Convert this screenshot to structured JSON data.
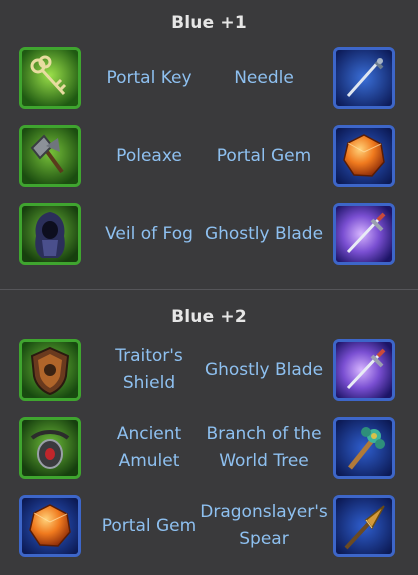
{
  "sections": [
    {
      "title": "Blue +1",
      "rows": [
        {
          "left": {
            "name": "Portal Key",
            "icon": "portal-key-icon"
          },
          "right": {
            "name": "Needle",
            "icon": "needle-icon"
          }
        },
        {
          "left": {
            "name": "Poleaxe",
            "icon": "poleaxe-icon"
          },
          "right": {
            "name": "Portal Gem",
            "icon": "portal-gem-icon"
          }
        },
        {
          "left": {
            "name": "Veil of Fog",
            "icon": "veil-of-fog-icon"
          },
          "right": {
            "name": "Ghostly Blade",
            "icon": "ghostly-blade-icon"
          }
        }
      ]
    },
    {
      "title": "Blue +2",
      "rows": [
        {
          "left": {
            "name": "Traitor's Shield",
            "icon": "traitors-shield-icon"
          },
          "right": {
            "name": "Ghostly Blade",
            "icon": "ghostly-blade-icon"
          }
        },
        {
          "left": {
            "name": "Ancient Amulet",
            "icon": "ancient-amulet-icon"
          },
          "right": {
            "name": "Branch of the World Tree",
            "icon": "world-tree-branch-icon"
          }
        },
        {
          "left": {
            "name": "Portal Gem",
            "icon": "portal-gem-icon"
          },
          "right": {
            "name": "Dragonslayer's Spear",
            "icon": "dragonslayer-spear-icon"
          }
        }
      ]
    }
  ],
  "colors": {
    "background": "#3a3a3c",
    "label": "#8ec0f0",
    "title": "#e6e6e6",
    "green_frame": "#3fa52f",
    "blue_frame": "#3d66c9"
  }
}
